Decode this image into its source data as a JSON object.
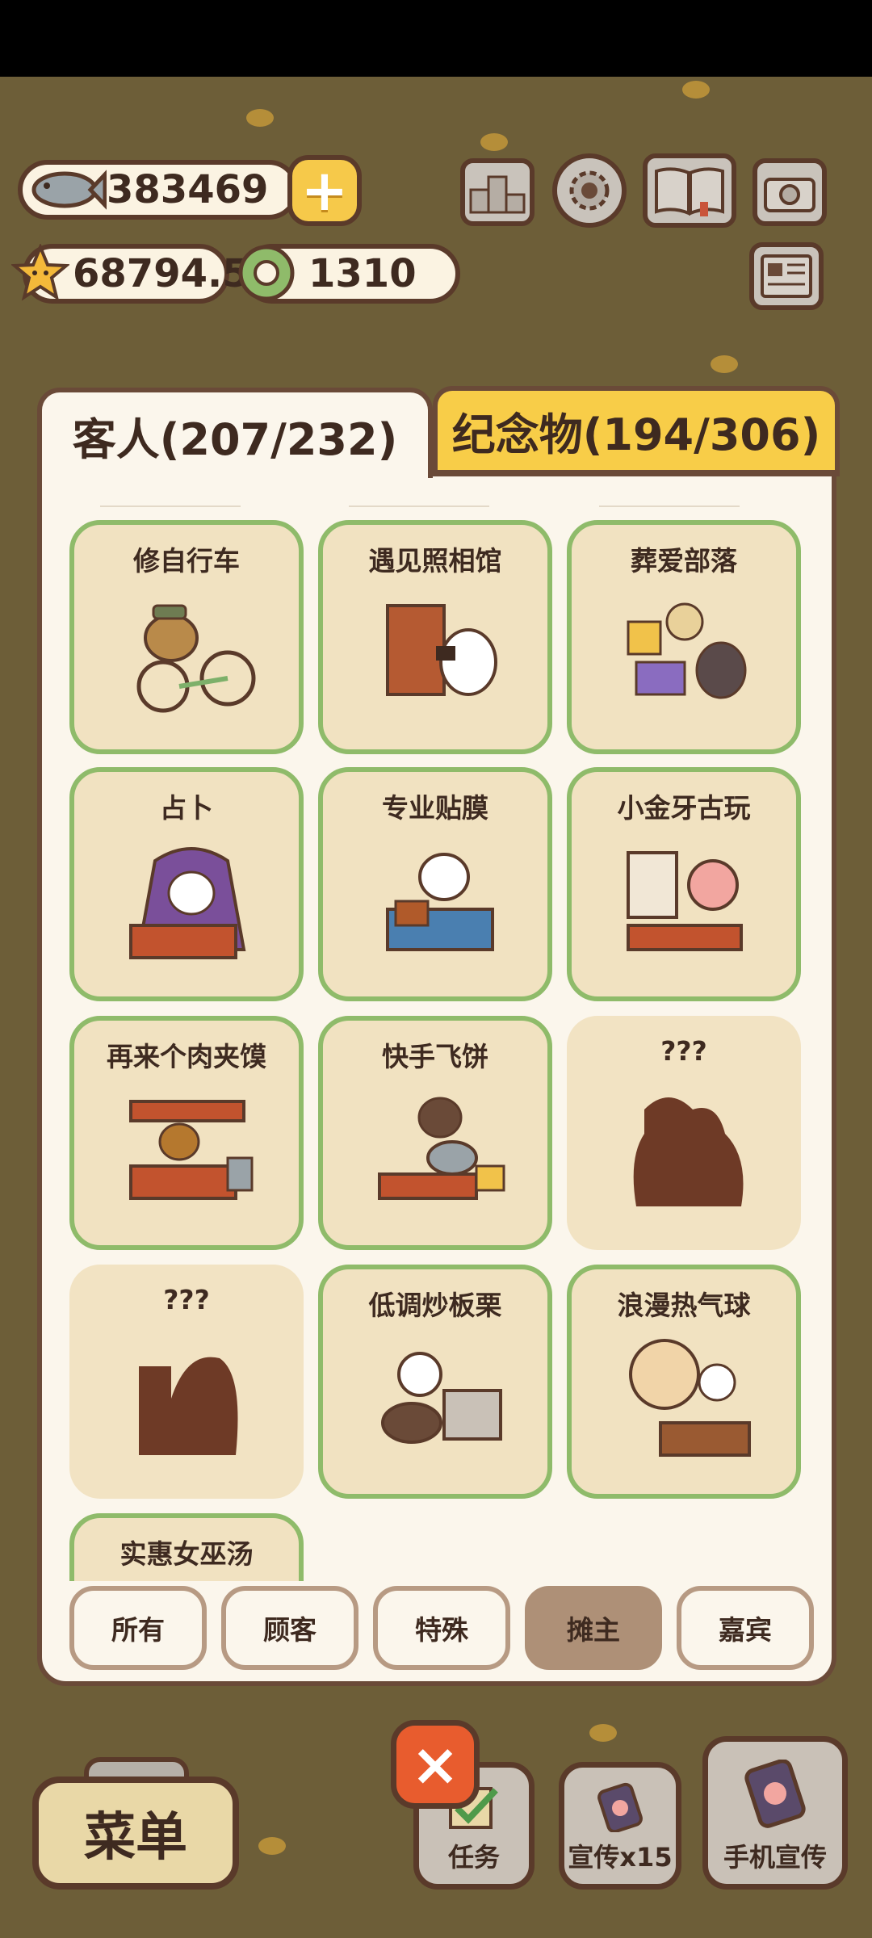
{
  "currency": {
    "fish": "383469",
    "star": "68794.5",
    "coin": "1310"
  },
  "tabs": {
    "guests": "客人(207/232)",
    "souvenirs": "纪念物(194/306)"
  },
  "cards": [
    {
      "title": "修自行车",
      "locked": false
    },
    {
      "title": "遇见照相馆",
      "locked": false
    },
    {
      "title": "葬爱部落",
      "locked": false
    },
    {
      "title": "占卜",
      "locked": false
    },
    {
      "title": "专业贴膜",
      "locked": false
    },
    {
      "title": "小金牙古玩",
      "locked": false
    },
    {
      "title": "再来个肉夹馍",
      "locked": false
    },
    {
      "title": "快手飞饼",
      "locked": false
    },
    {
      "title": "???",
      "locked": true
    },
    {
      "title": "???",
      "locked": true
    },
    {
      "title": "低调炒板栗",
      "locked": false
    },
    {
      "title": "浪漫热气球",
      "locked": false
    },
    {
      "title": "实惠女巫汤",
      "locked": false
    }
  ],
  "filters": {
    "all": "所有",
    "customers": "顾客",
    "special": "特殊",
    "vendors": "摊主",
    "guests": "嘉宾",
    "active": "vendors"
  },
  "bottom": {
    "menu": "菜单",
    "tasks": "任务",
    "promote": "宣传x15",
    "phone_promote": "手机宣传"
  },
  "colors": {
    "card_border": "#8fbb6a",
    "tab_inactive": "#f8cd48",
    "filter_active": "#ae9077",
    "close": "#e85c2e"
  }
}
